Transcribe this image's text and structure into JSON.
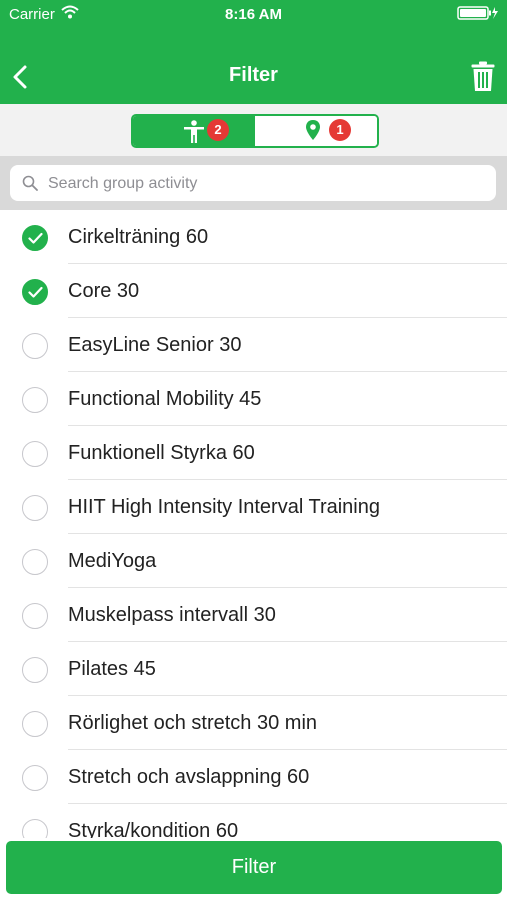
{
  "status_bar": {
    "carrier": "Carrier",
    "time": "8:16 AM"
  },
  "header": {
    "title": "Filter",
    "back_icon": "chevron-left-icon",
    "trash_icon": "trash-icon"
  },
  "segments": {
    "activities_badge": "2",
    "locations_badge": "1",
    "activities_icon": "person-icon",
    "locations_icon": "map-pin-icon",
    "active": "activities"
  },
  "search": {
    "placeholder": "Search group activity",
    "value": ""
  },
  "activities": [
    {
      "label": "Cirkelträning 60",
      "checked": true
    },
    {
      "label": "Core 30",
      "checked": true
    },
    {
      "label": "EasyLine Senior 30",
      "checked": false
    },
    {
      "label": "Functional Mobility 45",
      "checked": false
    },
    {
      "label": "Funktionell Styrka 60",
      "checked": false
    },
    {
      "label": "HIIT High Intensity Interval Training",
      "checked": false
    },
    {
      "label": "MediYoga",
      "checked": false
    },
    {
      "label": "Muskelpass intervall 30",
      "checked": false
    },
    {
      "label": "Pilates 45",
      "checked": false
    },
    {
      "label": "Rörlighet och stretch 30 min",
      "checked": false
    },
    {
      "label": "Stretch och avslappning 60",
      "checked": false
    },
    {
      "label": "Styrka/kondition 60",
      "checked": false
    }
  ],
  "footer": {
    "button_label": "Filter"
  },
  "colors": {
    "accent": "#22b14c",
    "badge": "#e53935",
    "separator": "#e3e3e3"
  }
}
